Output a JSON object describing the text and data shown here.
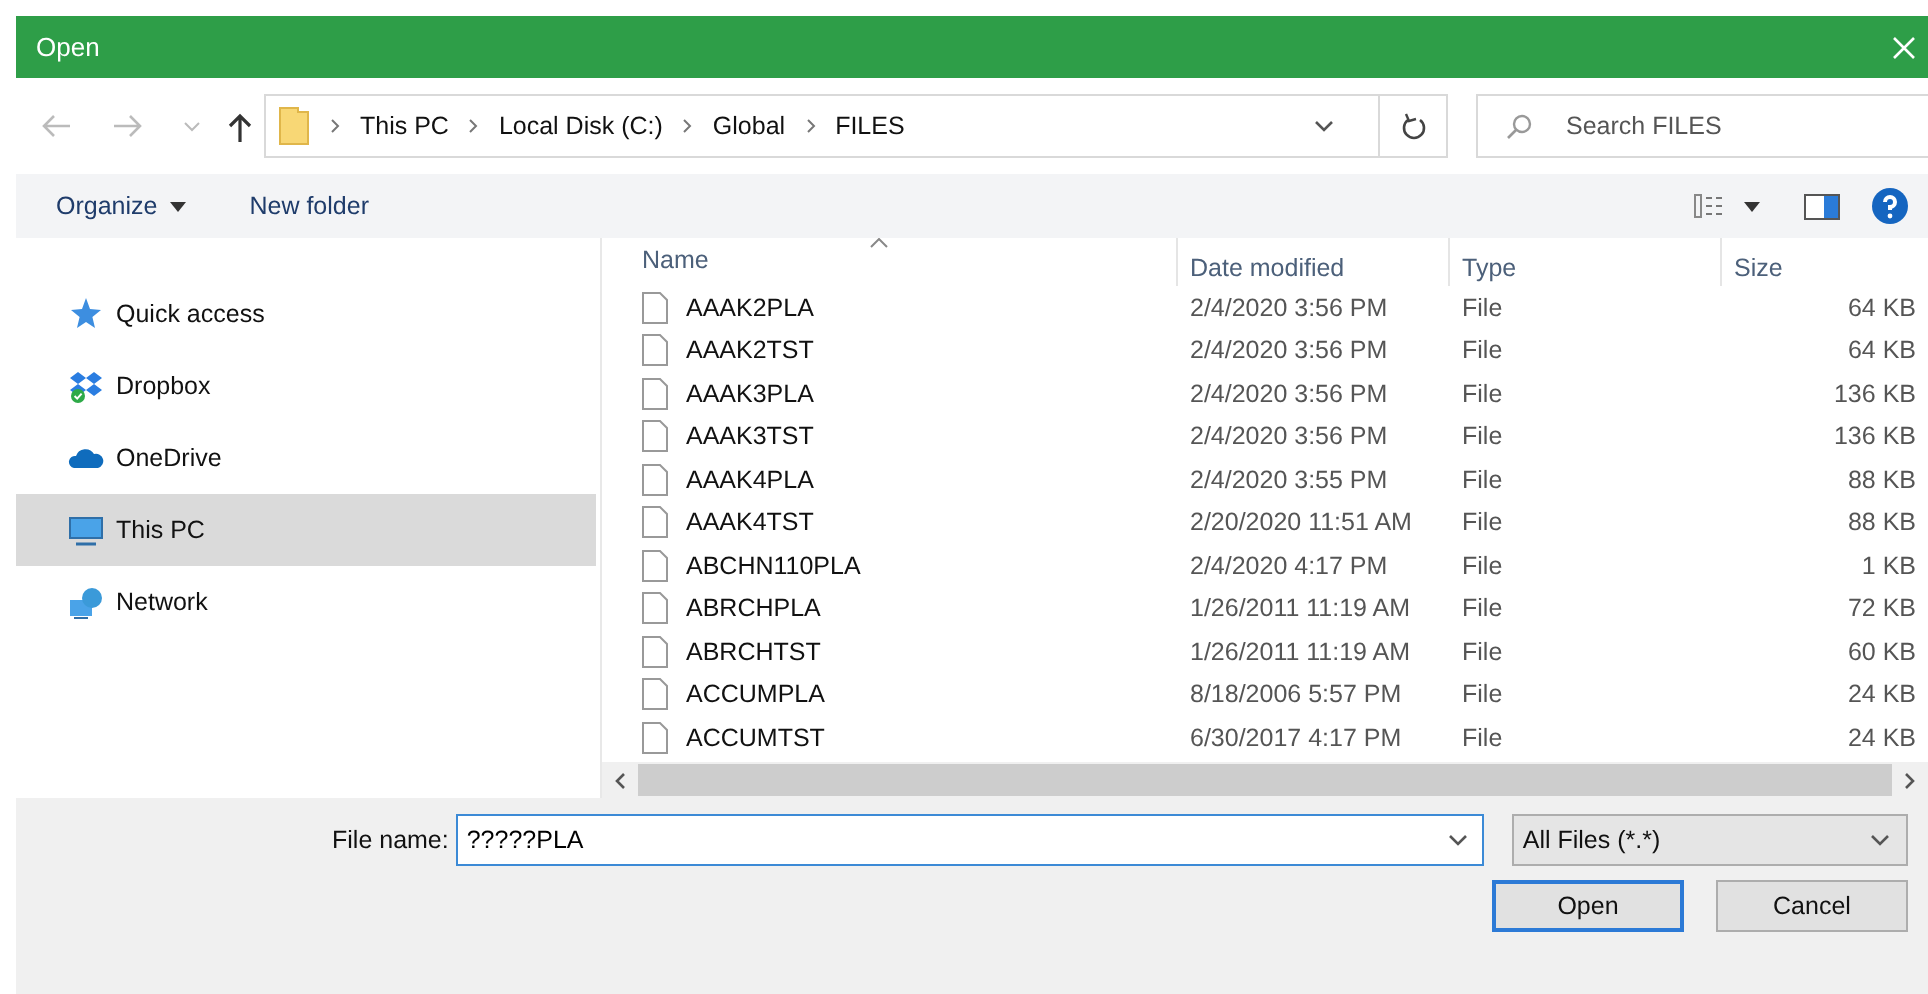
{
  "window": {
    "title": "Open"
  },
  "address": {
    "crumbs": [
      "This PC",
      "Local Disk (C:)",
      "Global",
      "FILES"
    ]
  },
  "search": {
    "placeholder": "Search FILES"
  },
  "toolbar": {
    "organize": "Organize",
    "new_folder": "New folder"
  },
  "sidebar": {
    "items": [
      {
        "label": "Quick access",
        "kind": "star",
        "selected": false
      },
      {
        "label": "Dropbox",
        "kind": "dropbox",
        "selected": false
      },
      {
        "label": "OneDrive",
        "kind": "cloud",
        "selected": false
      },
      {
        "label": "This PC",
        "kind": "pc",
        "selected": true
      },
      {
        "label": "Network",
        "kind": "network",
        "selected": false
      }
    ]
  },
  "table": {
    "columns": [
      "Name",
      "Date modified",
      "Type",
      "Size"
    ],
    "rows": [
      [
        "AAAK2PLA",
        "2/4/2020 3:56 PM",
        "File",
        "64 KB"
      ],
      [
        "AAAK2TST",
        "2/4/2020 3:56 PM",
        "File",
        "64 KB"
      ],
      [
        "AAAK3PLA",
        "2/4/2020 3:56 PM",
        "File",
        "136 KB"
      ],
      [
        "AAAK3TST",
        "2/4/2020 3:56 PM",
        "File",
        "136 KB"
      ],
      [
        "AAAK4PLA",
        "2/4/2020 3:55 PM",
        "File",
        "88 KB"
      ],
      [
        "AAAK4TST",
        "2/20/2020 11:51 AM",
        "File",
        "88 KB"
      ],
      [
        "ABCHN110PLA",
        "2/4/2020 4:17 PM",
        "File",
        "1 KB"
      ],
      [
        "ABRCHPLA",
        "1/26/2011 11:19 AM",
        "File",
        "72 KB"
      ],
      [
        "ABRCHTST",
        "1/26/2011 11:19 AM",
        "File",
        "60 KB"
      ],
      [
        "ACCUMPLA",
        "8/18/2006 5:57 PM",
        "File",
        "24 KB"
      ],
      [
        "ACCUMTST",
        "6/30/2017 4:17 PM",
        "File",
        "24 KB"
      ]
    ]
  },
  "footer": {
    "file_name_label": "File name:",
    "file_name": "?????PLA",
    "filter": "All Files (*.*)",
    "buttons": [
      {
        "label": "Open",
        "kind": "default"
      },
      {
        "label": "Cancel",
        "kind": "normal"
      }
    ]
  }
}
